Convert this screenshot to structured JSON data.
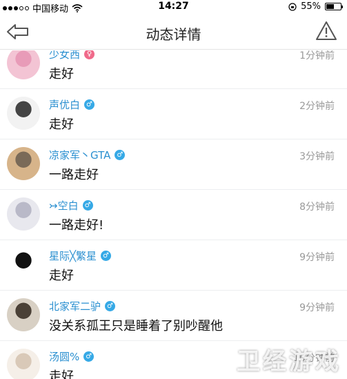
{
  "status_bar": {
    "carrier": "中国移动",
    "time": "14:27",
    "battery": "55%",
    "battery_level": 0.55
  },
  "nav": {
    "title": "动态详情",
    "back_icon": "back-arrow-icon",
    "report_icon": "warning-icon"
  },
  "comments": [
    {
      "name": "少女西",
      "gender": "female",
      "time": "1分钟前",
      "text": "走好",
      "avatar_colors": [
        "#f3c4d4",
        "#e89bb8"
      ]
    },
    {
      "name": "声优白",
      "gender": "male",
      "time": "2分钟前",
      "text": "走好",
      "avatar_colors": [
        "#f2f2f2",
        "#444444"
      ]
    },
    {
      "name": "凉家军丶GTA",
      "gender": "male",
      "time": "3分钟前",
      "text": "一路走好",
      "avatar_colors": [
        "#d7b48a",
        "#7a6a58"
      ]
    },
    {
      "name": "↣空白",
      "gender": "male",
      "time": "8分钟前",
      "text": "一路走好!",
      "avatar_colors": [
        "#e8e8ee",
        "#b9b9c8"
      ]
    },
    {
      "name": "星际╳繁星",
      "gender": "male",
      "time": "9分钟前",
      "text": "走好",
      "avatar_colors": [
        "#ffffff",
        "#111111"
      ]
    },
    {
      "name": "北家军二驴",
      "gender": "male",
      "time": "9分钟前",
      "text": "没关系孤王只是睡着了别吵醒他",
      "avatar_colors": [
        "#d8d0c4",
        "#4a4036"
      ]
    },
    {
      "name": "汤圆%",
      "gender": "male",
      "time": "10分钟前",
      "text": "走好",
      "avatar_colors": [
        "#f5efe8",
        "#d9c9b8"
      ]
    }
  ],
  "watermark": "卫经游戏",
  "colors": {
    "accent": "#2a8fd0",
    "male": "#36a9e6",
    "female": "#f06a8a"
  }
}
